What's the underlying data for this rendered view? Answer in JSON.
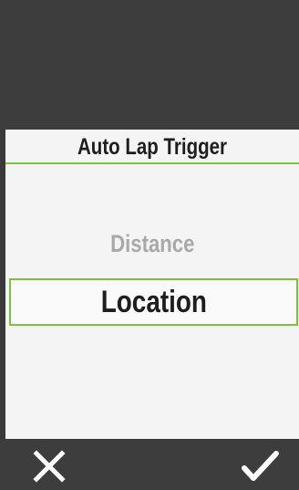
{
  "screen": {
    "title": "Auto Lap Trigger",
    "options": [
      {
        "label": "Distance",
        "selected": false
      },
      {
        "label": "Location",
        "selected": true
      }
    ]
  },
  "actions": {
    "cancel_icon": "close-icon",
    "confirm_icon": "checkmark-icon"
  },
  "colors": {
    "accent": "#7dc142",
    "dark_bar": "#3d3d3d",
    "panel": "#f4f4f4",
    "text": "#1e1e1e",
    "dim_text": "#a9a9a9"
  }
}
